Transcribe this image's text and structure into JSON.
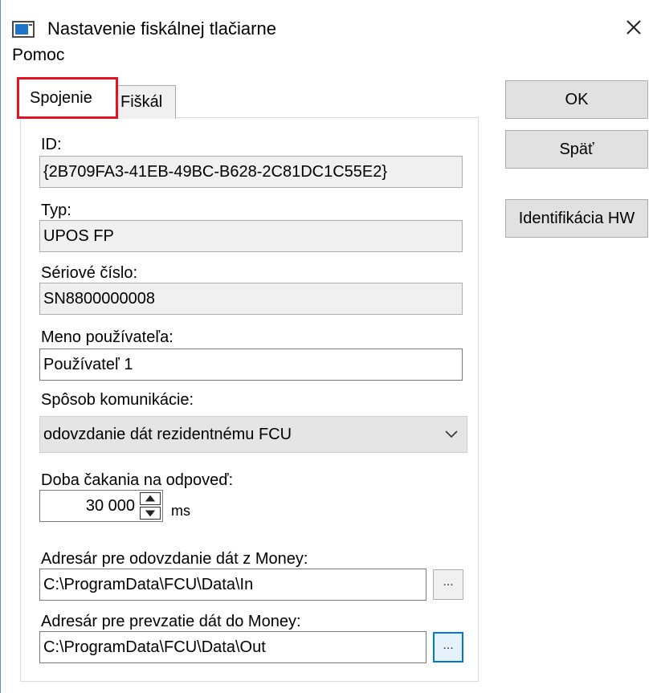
{
  "window": {
    "title": "Nastavenie fiskálnej tlačiarne",
    "close_glyph": "✕"
  },
  "menu": {
    "items": [
      {
        "label": "Pomoc"
      }
    ]
  },
  "tabs": [
    {
      "label": "Spojenie",
      "active": true
    },
    {
      "label": "Fiškál",
      "active": false
    }
  ],
  "form": {
    "id_label": "ID:",
    "id_value": "{2B709FA3-41EB-49BC-B628-2C81DC1C55E2}",
    "type_label": "Typ:",
    "type_value": "UPOS FP",
    "serial_label": "Sériové číslo:",
    "serial_value": "SN8800000008",
    "username_label": "Meno používateľa:",
    "username_value": "Používateľ 1",
    "comm_label": "Spôsob komunikácie:",
    "comm_value": "odovzdanie dát rezidentnému FCU",
    "timeout_label": "Doba čakania na odpoveď:",
    "timeout_value": "30 000",
    "timeout_unit": "ms",
    "out_dir_label": "Adresár pre odovzdanie dát z Money:",
    "out_dir_value": "C:\\ProgramData\\FCU\\Data\\In",
    "in_dir_label": "Adresár pre prevzatie dát do Money:",
    "in_dir_value": "C:\\ProgramData\\FCU\\Data\\Out",
    "browse_label": "..."
  },
  "buttons": {
    "ok": "OK",
    "back": "Späť",
    "hw_id": "Identifikácia HW"
  },
  "icons": {
    "app": "printer-window-icon",
    "close": "close-icon",
    "combo": "chevron-down-icon",
    "spin_up": "spin-up-icon",
    "spin_down": "spin-down-icon"
  },
  "colors": {
    "tab_highlight": "#e81123",
    "focus": "#0078d7",
    "readonly_bg": "#f0f0f0",
    "button_bg": "#e1e1e1"
  }
}
